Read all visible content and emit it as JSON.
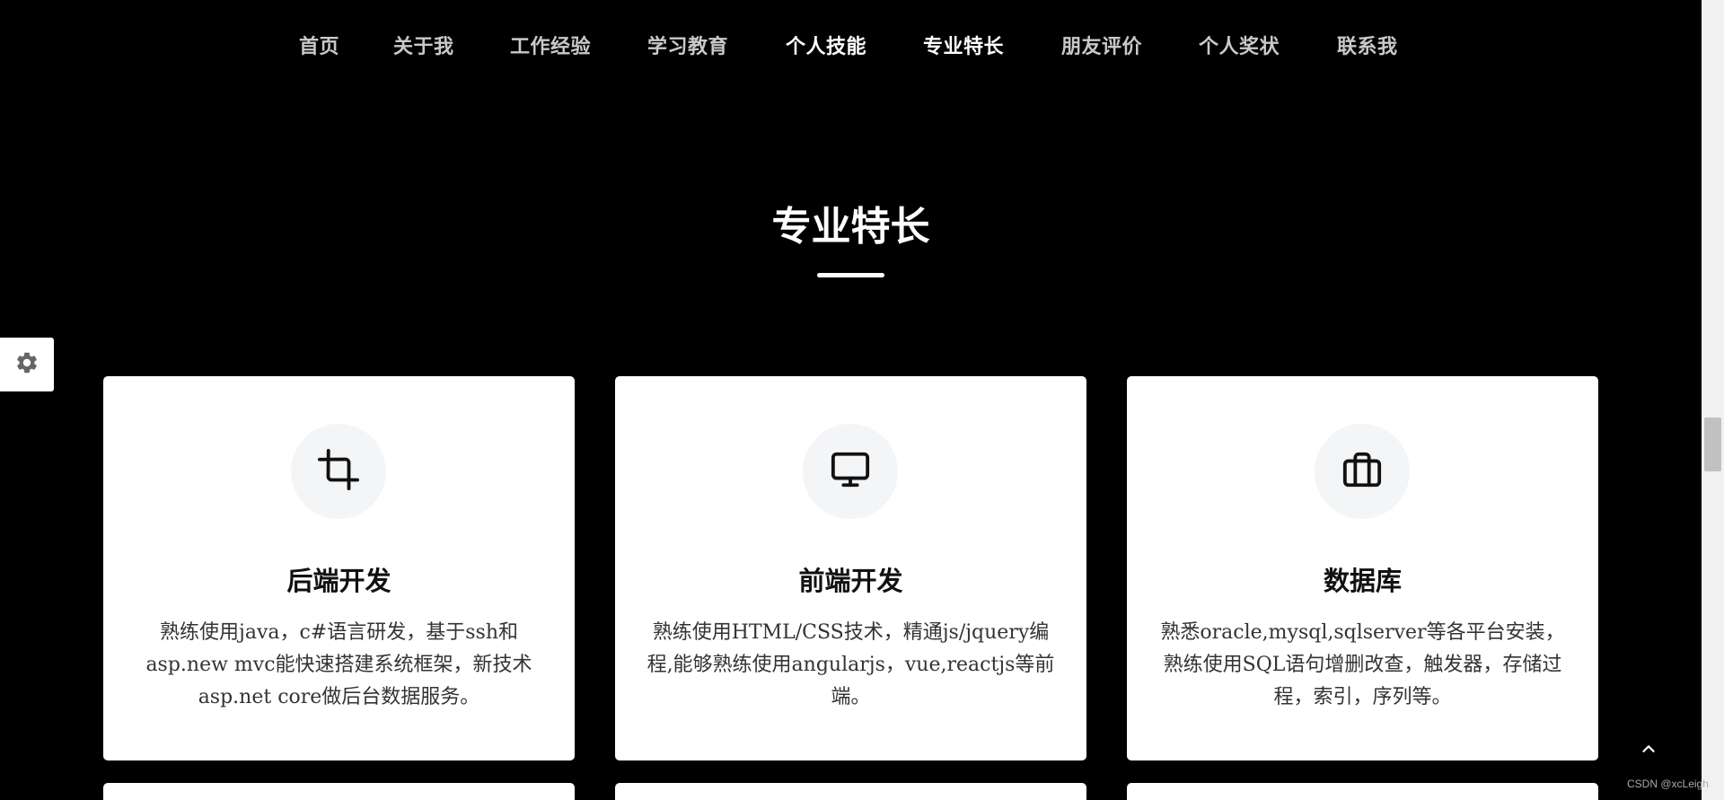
{
  "nav": {
    "items": [
      {
        "label": "首页"
      },
      {
        "label": "关于我"
      },
      {
        "label": "工作经验"
      },
      {
        "label": "学习教育"
      },
      {
        "label": "个人技能"
      },
      {
        "label": "专业特长"
      },
      {
        "label": "朋友评价"
      },
      {
        "label": "个人奖状"
      },
      {
        "label": "联系我"
      }
    ]
  },
  "section": {
    "title": "专业特长"
  },
  "cards": [
    {
      "icon": "crop-icon",
      "title": "后端开发",
      "desc": "熟练使用java，c#语言研发，基于ssh和asp.new mvc能快速搭建系统框架，新技术asp.net core做后台数据服务。"
    },
    {
      "icon": "monitor-icon",
      "title": "前端开发",
      "desc": "熟练使用HTML/CSS技术，精通js/jquery编程,能够熟练使用angularjs，vue,reactjs等前端。"
    },
    {
      "icon": "briefcase-icon",
      "title": "数据库",
      "desc": "熟悉oracle,mysql,sqlserver等各平台安装，熟练使用SQL语句增删改查，触发器，存储过程，索引，序列等。"
    }
  ],
  "widgets": {
    "settings_icon": "gear-icon",
    "back_top_icon": "chevron-up-icon"
  },
  "watermark": "CSDN @xcLeigh"
}
